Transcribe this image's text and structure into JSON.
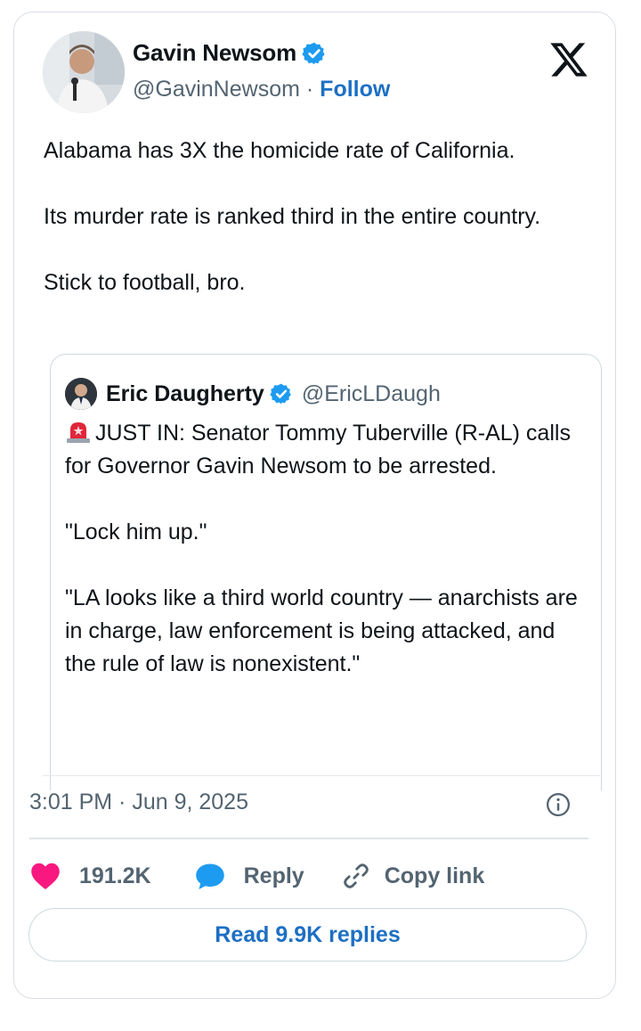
{
  "author": {
    "name": "Gavin Newsom",
    "handle": "@GavinNewsom",
    "separator": "·",
    "follow_label": "Follow"
  },
  "tweet": {
    "lines": [
      "Alabama has 3X the homicide rate of California.",
      "Its murder rate is ranked third in the entire country.",
      "Stick to football, bro."
    ]
  },
  "quoted": {
    "name": "Eric Daugherty",
    "handle": "@EricLDaugh",
    "text": [
      "JUST IN: Senator Tommy Tuberville (R-AL) calls for Governor Gavin Newsom to be arrested.",
      "\"Lock him up.\"",
      "\"LA looks like a third world country — anarchists are in charge, law enforcement is being attacked, and the rule of law is nonexistent.\""
    ]
  },
  "meta": {
    "timestamp": "3:01 PM · Jun 9, 2025"
  },
  "actions": {
    "like_count": "191.2K",
    "reply_label": "Reply",
    "copy_label": "Copy link"
  },
  "read_replies_label": "Read 9.9K replies",
  "colors": {
    "link_blue": "#1d6fc4",
    "verified_blue": "#1d9bf0",
    "like_pink": "#f91880",
    "muted_text": "#536471"
  },
  "icons": {
    "logo": "x-logo-icon",
    "verified": "verified-badge-icon",
    "siren": "siren-emoji-icon",
    "info": "info-icon",
    "like": "heart-icon",
    "reply": "speech-bubble-icon",
    "copy": "link-icon"
  }
}
